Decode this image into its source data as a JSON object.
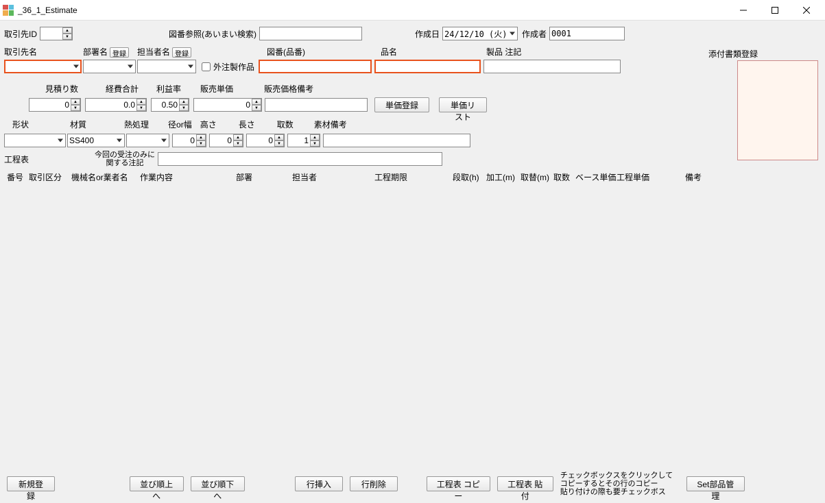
{
  "window": {
    "title": "_36_1_Estimate"
  },
  "labels": {
    "client_id": "取引先ID",
    "drawing_search": "図番参照(あいまい検索)",
    "create_date": "作成日",
    "creator": "作成者",
    "attach": "添付書類登録",
    "client_name": "取引先名",
    "dept": "部署名",
    "dept_btn": "登録",
    "person": "担当者名",
    "person_btn": "登録",
    "outsource": "外注製作品",
    "drawing_no": "図番(品番)",
    "product_name": "品名",
    "product_note": "製品  注記",
    "qty": "見積り数",
    "expense": "経費合計",
    "profit": "利益率",
    "sell_unit": "販売単価",
    "sell_note": "販売価格備考",
    "unit_reg": "単価登録",
    "unit_list": "単価リスト",
    "shape": "形状",
    "material": "材質",
    "heat": "熱処理",
    "diam": "径or幅",
    "height": "高さ",
    "length": "長さ",
    "cnt": "取数",
    "mat_note": "素材備考",
    "process_table": "工程表",
    "order_note": "今回の受注のみに\n関する注記"
  },
  "values": {
    "client_id": "",
    "create_date": "24/12/10 (火)",
    "creator": "0001",
    "qty": "0",
    "expense": "0.0",
    "profit": "0.50",
    "sell_unit": "0",
    "material": "SS400",
    "diam": "0",
    "height": "0",
    "length": "0",
    "cnt": "1"
  },
  "proc_cols": {
    "no": "番号",
    "type": "取引区分",
    "machine": "機械名or業者名",
    "work": "作業内容",
    "dept": "部署",
    "person": "担当者",
    "deadline": "工程期限",
    "setup": "段取(h)",
    "process": "加工(m)",
    "change": "取替(m)",
    "cnt": "取数",
    "base": "ベース単価",
    "proc_unit": "工程単価",
    "note": "備考"
  },
  "bottom": {
    "new": "新規登録",
    "up": "並び順上へ",
    "down": "並び順下へ",
    "insert": "行挿入",
    "delete": "行削除",
    "copy": "工程表 コピー",
    "paste": "工程表 貼付",
    "hint": "チェックボックスをクリックして\nコピーするとその行のコピー\n貼り付けの際も要チェックボス",
    "set_parts": "Set部品管理"
  }
}
